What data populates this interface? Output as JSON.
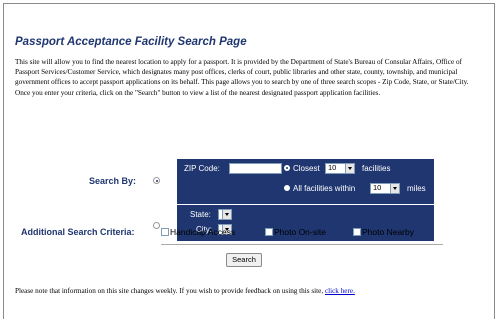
{
  "page": {
    "title": "Passport Acceptance Facility Search Page",
    "intro": "This site will allow you to find the nearest location to apply for a passport. It is provided by the Department of State's Bureau of Consular Affairs, Office of Passport Services/Customer Service, which designates many post offices, clerks of court, public libraries and other state, county, township, and municipal government offices to accept passport applications on its behalf. This page allows you to search by one of three search scopes - Zip Code, State, or State/City.  Once you enter your criteria, click on the \"Search\" button to view a list of the nearest designated passport application facilities."
  },
  "search": {
    "label": "Search By:",
    "zip": {
      "label": "ZIP Code:",
      "value": "",
      "closest_label": "Closest",
      "closest_value": "10",
      "facilities_label": "facilities",
      "all_within_label": "All facilities within",
      "within_value": "10",
      "miles_label": "miles"
    },
    "state": {
      "state_label": "State:",
      "state_value": "",
      "city_label": "City:",
      "city_value": ""
    }
  },
  "additional": {
    "label": "Additional Search Criteria:",
    "options": [
      "Handicap Access",
      "Photo On-site",
      "Photo Nearby"
    ]
  },
  "actions": {
    "search_label": "Search"
  },
  "footer": {
    "note": "Please note that information on this site changes weekly. If you wish to provide feedback on using this site, ",
    "link": "click here."
  },
  "colors": {
    "accent": "#1f3670",
    "link": "#0000cc"
  }
}
